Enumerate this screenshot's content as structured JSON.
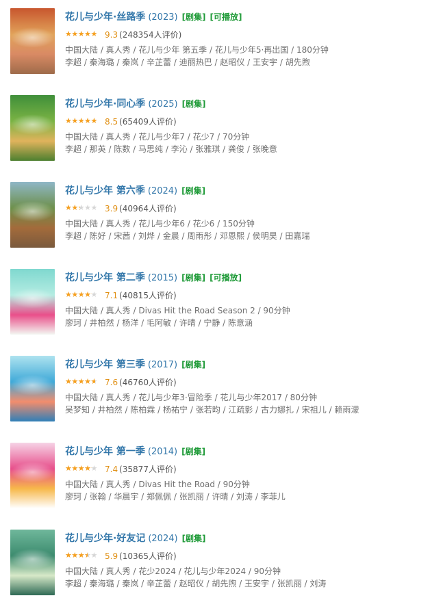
{
  "colors": {
    "title": "#3377aa",
    "tag": "#1e9a37",
    "star": "#f7a01e",
    "score": "#e09015"
  },
  "items": [
    {
      "title": "花儿与少年·丝路季",
      "year": "(2023)",
      "tags": [
        "[剧集]",
        "[可播放]"
      ],
      "stars": 4.5,
      "score": "9.3",
      "count": "(248354人评价)",
      "info": "中国大陆 / 真人秀 / 花儿与少年 第五季 / 花儿与少年5·再出国 / 180分钟",
      "cast": "李超 / 秦海璐 / 秦岚 / 辛芷蕾 / 迪丽热巴 / 赵昭仪 / 王安宇 / 胡先煦",
      "poster_colors": [
        "#c8562e",
        "#e1a35a",
        "#d98a64",
        "#9e6b4a"
      ]
    },
    {
      "title": "花儿与少年·同心季",
      "year": "(2025)",
      "tags": [
        "[剧集]"
      ],
      "stars": 4.5,
      "score": "8.5",
      "count": "(65409人评价)",
      "info": "中国大陆 / 真人秀 / 花儿与少年7 / 花少7 / 70分钟",
      "cast": "李超 / 那英 / 陈数 / 马思纯 / 李沁 / 张雅琪 / 龚俊 / 张晚意",
      "poster_colors": [
        "#3f8f3a",
        "#7bb344",
        "#e0b35c",
        "#4d7f2f"
      ]
    },
    {
      "title": "花儿与少年 第六季",
      "year": "(2024)",
      "tags": [
        "[剧集]"
      ],
      "stars": 2,
      "score": "3.9",
      "count": "(40964人评价)",
      "info": "中国大陆 / 真人秀 / 花儿与少年6 / 花少6 / 150分钟",
      "cast": "李超 / 陈好 / 宋茜 / 刘烨 / 金晨 / 周雨彤 / 邓恩熙 / 侯明昊 / 田嘉瑞",
      "poster_colors": [
        "#8fb7c6",
        "#6d8f4a",
        "#a36b3b",
        "#7a5a3d"
      ]
    },
    {
      "title": "花儿与少年 第二季",
      "year": "(2015)",
      "tags": [
        "[剧集]",
        "[可播放]"
      ],
      "stars": 3.5,
      "score": "7.1",
      "count": "(40815人评价)",
      "info": "中国大陆 / 真人秀 / Divas Hit the Road Season 2 / 90分钟",
      "cast": "廖珂 / 井柏然 / 杨洋 / 毛阿敏 / 许晴 / 宁静 / 陈意涵",
      "poster_colors": [
        "#7fd8cf",
        "#b4ece2",
        "#e94f8a",
        "#f3f7f2"
      ]
    },
    {
      "title": "花儿与少年 第三季",
      "year": "(2017)",
      "tags": [
        "[剧集]"
      ],
      "stars": 4,
      "score": "7.6",
      "count": "(46760人评价)",
      "info": "中国大陆 / 真人秀 / 花儿与少年3·冒险季 / 花儿与少年2017 / 80分钟",
      "cast": "吴梦知 / 井柏然 / 陈柏霖 / 杨祐宁 / 张若昀 / 江疏影 / 古力娜扎 / 宋祖儿 / 赖雨濛",
      "poster_colors": [
        "#aee3ef",
        "#3fa9d8",
        "#f28d6d",
        "#2f7fb8"
      ]
    },
    {
      "title": "花儿与少年 第一季",
      "year": "(2014)",
      "tags": [
        "[剧集]"
      ],
      "stars": 3.5,
      "score": "7.4",
      "count": "(35877人评价)",
      "info": "中国大陆 / 真人秀 / Divas Hit the Road / 90分钟",
      "cast": "廖珂 / 张翰 / 华晨宇 / 郑佩佩 / 张凯丽 / 许晴 / 刘涛 / 李菲儿",
      "poster_colors": [
        "#f6d3e6",
        "#e74e8a",
        "#f7b84a",
        "#ffffff"
      ]
    },
    {
      "title": "花儿与少年·好友记",
      "year": "(2024)",
      "tags": [
        "[剧集]"
      ],
      "stars": 3,
      "score": "5.9",
      "count": "(10365人评价)",
      "info": "中国大陆 / 真人秀 / 花少2024 / 花儿与少年2024 / 90分钟",
      "cast": "李超 / 秦海璐 / 秦岚 / 辛芷蕾 / 赵昭仪 / 胡先煦 / 王安宇 / 张凯丽 / 刘涛",
      "poster_colors": [
        "#6fb79b",
        "#3c8b6e",
        "#d7e9c8",
        "#2f6a55"
      ]
    }
  ]
}
